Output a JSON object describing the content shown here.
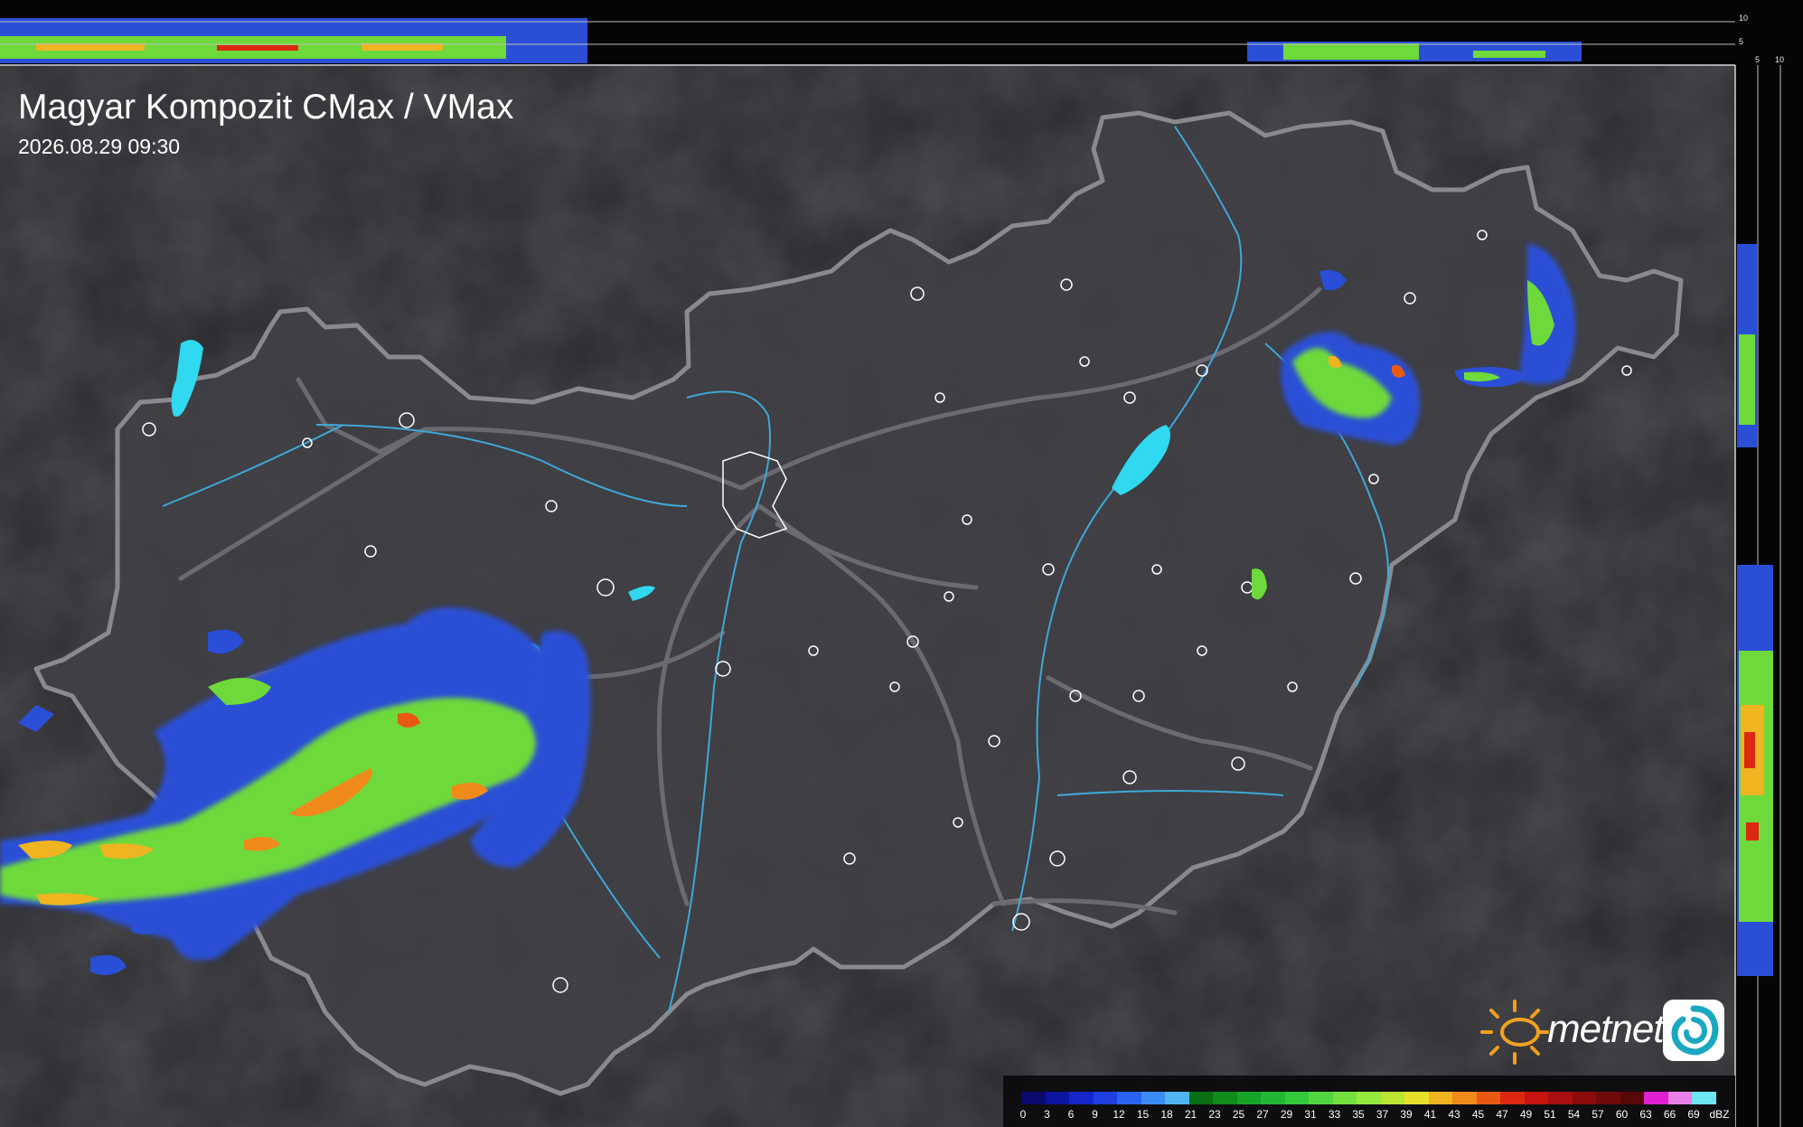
{
  "map": {
    "title": "Magyar Kompozit CMax / VMax",
    "timestamp": "2026.08.29 09:30",
    "units": "dBZ",
    "brand": "metnet"
  },
  "side_profile": {
    "top_scale_labels": [
      "10",
      "5"
    ],
    "side_scale_labels": [
      "5",
      "10"
    ]
  },
  "legend": {
    "unit_label": "dBZ",
    "values": [
      "0",
      "3",
      "6",
      "9",
      "12",
      "15",
      "18",
      "21",
      "23",
      "25",
      "27",
      "29",
      "31",
      "33",
      "35",
      "37",
      "39",
      "41",
      "43",
      "45",
      "47",
      "49",
      "51",
      "54",
      "57",
      "60",
      "63",
      "66",
      "69"
    ],
    "colors": [
      "#0a0a6e",
      "#0c14a0",
      "#1426c8",
      "#1e3ee0",
      "#2864f0",
      "#3c8cf5",
      "#4fb4f0",
      "#0a6e14",
      "#0f8c1c",
      "#17a428",
      "#22b834",
      "#34c83c",
      "#52d640",
      "#74e040",
      "#96e83c",
      "#bce434",
      "#e6e02a",
      "#f0b420",
      "#f08a1a",
      "#e85a14",
      "#dc2810",
      "#c8140e",
      "#a81010",
      "#8c0c0c",
      "#6e0a0a",
      "#560808",
      "#e020d0",
      "#e880e8",
      "#6ee6f0"
    ]
  },
  "colors": {
    "background": "#2a2a2e",
    "country_fill": "#404046",
    "border": "#8a8a8e",
    "rivers": "#3fa8d8",
    "lakes": "#30d8f0",
    "roads": "#6a6a70"
  },
  "icons": [
    "metnet-sun-logo",
    "metnet-badge-logo"
  ]
}
